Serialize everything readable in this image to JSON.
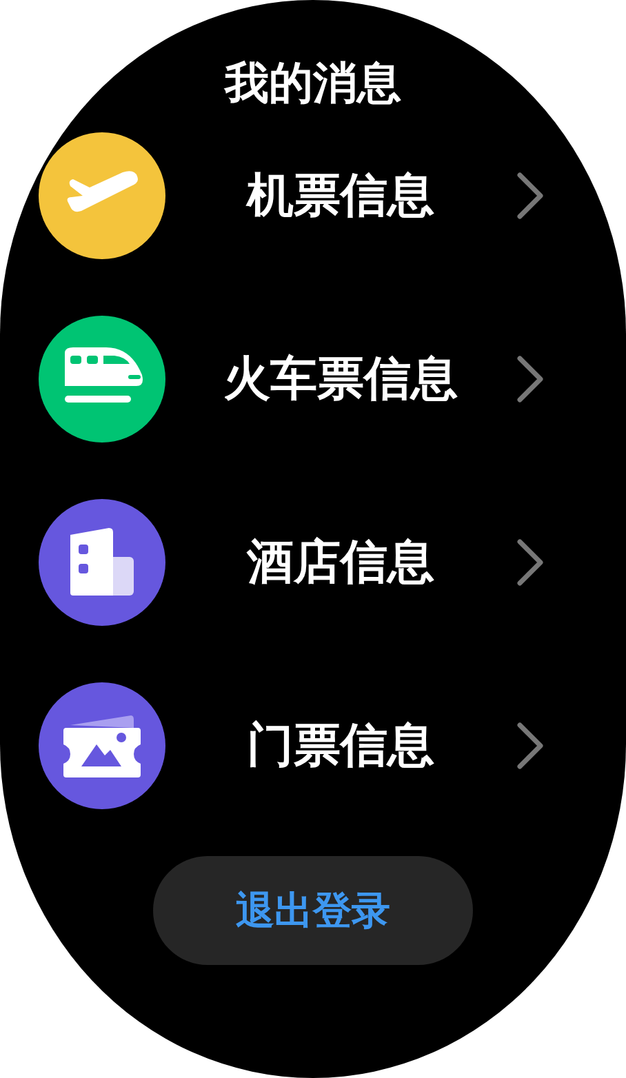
{
  "title": "我的消息",
  "items": [
    {
      "label": "机票信息",
      "kind": "plane",
      "color": "#f4c43c"
    },
    {
      "label": "火车票信息",
      "kind": "train",
      "color": "#00c473"
    },
    {
      "label": "酒店信息",
      "kind": "hotel",
      "color": "#6657de"
    },
    {
      "label": "门票信息",
      "kind": "ticket",
      "color": "#6657de"
    }
  ],
  "logout_button": "退出登录"
}
